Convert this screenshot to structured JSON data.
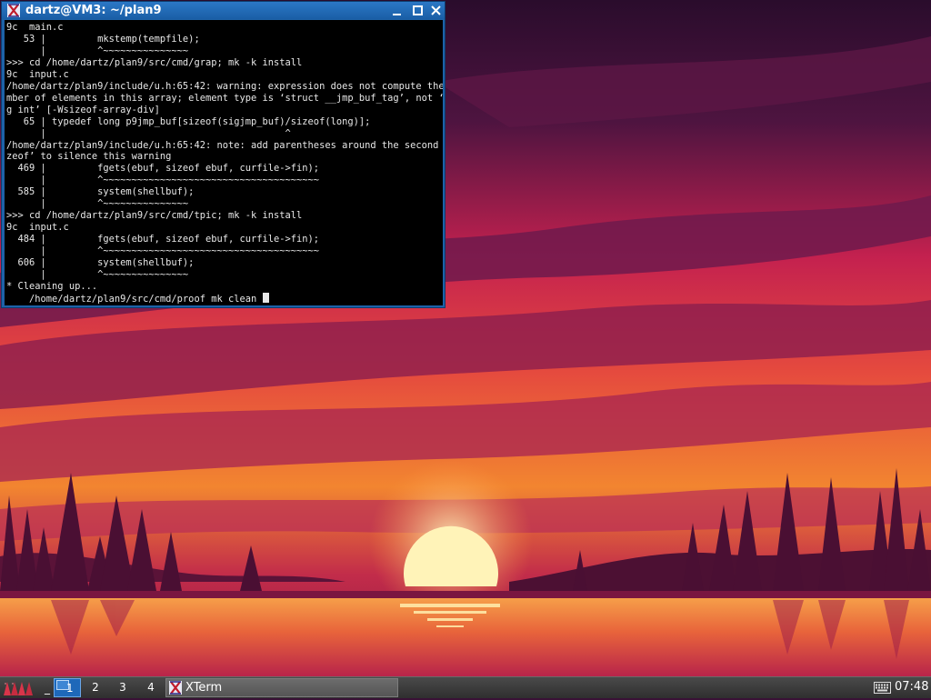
{
  "window": {
    "title": "dartz@VM3: ~/plan9",
    "app_icon": "plan9-x-icon",
    "controls": [
      "minimize-icon",
      "maximize-icon",
      "close-icon"
    ]
  },
  "terminal": {
    "lines": [
      "9c  main.c",
      "   53 |         mkstemp(tempfile);",
      "      |         ^~~~~~~~~~~~~~~~",
      ">>> cd /home/dartz/plan9/src/cmd/grap; mk -k install",
      "9c  input.c",
      "/home/dartz/plan9/include/u.h:65:42: warning: expression does not compute the nu",
      "mber of elements in this array; element type is ‘struct __jmp_buf_tag’, not ‘lon",
      "g int’ [-Wsizeof-array-div]",
      "   65 | typedef long p9jmp_buf[sizeof(sigjmp_buf)/sizeof(long)];",
      "      |                                          ^",
      "/home/dartz/plan9/include/u.h:65:42: note: add parentheses around the second ‘si",
      "zeof’ to silence this warning",
      "  469 |         fgets(ebuf, sizeof ebuf, curfile->fin);",
      "      |         ^~~~~~~~~~~~~~~~~~~~~~~~~~~~~~~~~~~~~~~",
      "  585 |         system(shellbuf);",
      "      |         ^~~~~~~~~~~~~~~~",
      ">>> cd /home/dartz/plan9/src/cmd/tpic; mk -k install",
      "9c  input.c",
      "  484 |         fgets(ebuf, sizeof ebuf, curfile->fin);",
      "      |         ^~~~~~~~~~~~~~~~~~~~~~~~~~~~~~~~~~~~~~~",
      "  606 |         system(shellbuf);",
      "      |         ^~~~~~~~~~~~~~~~",
      "* Cleaning up...",
      "    /home/dartz/plan9/src/cmd/proof mk clean "
    ]
  },
  "taskbar": {
    "show_desktop_label": "_",
    "workspaces": [
      "1",
      "2",
      "3",
      "4"
    ],
    "active_workspace": "1",
    "task_label": "XTerm",
    "tray_icon": "keyboard-icon",
    "clock": "07:48"
  },
  "colors": {
    "titlebar": "#1d62a8",
    "terminal_bg": "#000000",
    "terminal_fg": "#e8e8e8",
    "taskbar": "#3a3a3a",
    "active_workspace": "#1e68b9"
  }
}
